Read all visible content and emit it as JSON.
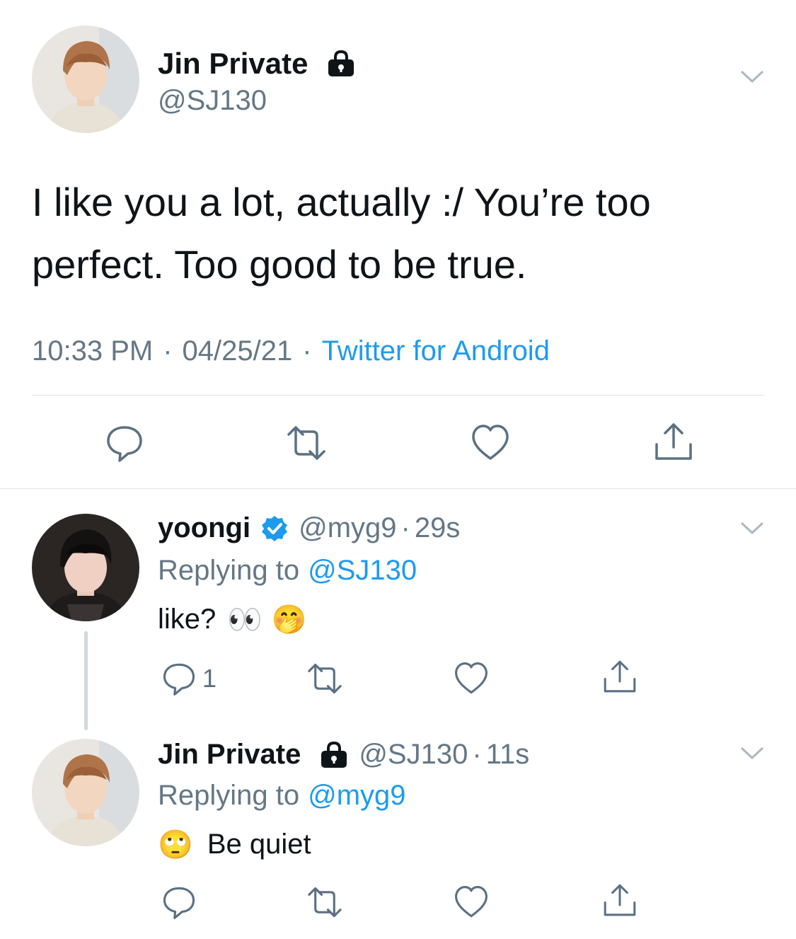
{
  "main_tweet": {
    "display_name": "Jin Private",
    "handle": "@SJ130",
    "text_line1": "I like you a lot, actually :/ You’re too",
    "text_line2": "perfect. Too good to be true.",
    "time": "10:33 PM",
    "date": "04/25/21",
    "source": "Twitter for Android",
    "separator": "·"
  },
  "reply1": {
    "display_name": "yoongi",
    "handle": "@myg9",
    "age": "29s",
    "separator": "·",
    "replying_prefix": "Replying to",
    "replying_to": "@SJ130",
    "text": "like?",
    "emojis": "👀 🤭",
    "reply_count": "1"
  },
  "reply2": {
    "display_name": "Jin Private",
    "handle": "@SJ130",
    "age": "11s",
    "separator": "·",
    "replying_prefix": "Replying to",
    "replying_to": "@myg9",
    "emoji": "🙄",
    "text": "Be quiet"
  },
  "colors": {
    "link": "#1d9bf0",
    "muted": "#657786",
    "verified": "#1d9bf0"
  }
}
